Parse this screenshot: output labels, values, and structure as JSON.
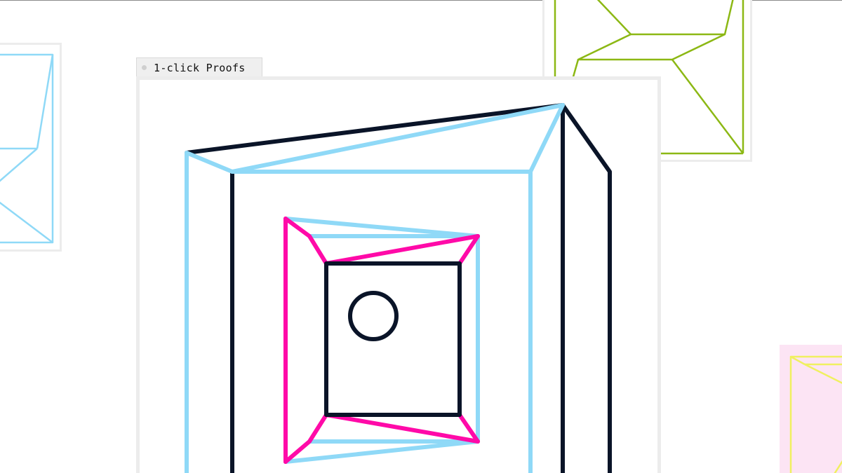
{
  "window": {
    "title": "1-click Proofs"
  },
  "icons": {
    "tab_dot": "window-status-dot",
    "main_artwork": "nested-frame-illustration",
    "left_thumbnail": "cyan-frame-thumbnail",
    "green_thumbnail": "green-frame-thumbnail",
    "pink_thumbnail": "yellow-frame-thumbnail"
  },
  "colors": {
    "background": "#ffffff",
    "frame_border": "#ececec",
    "navy": "#0a1428",
    "cyan": "#8fd9f7",
    "magenta": "#ff0aa8",
    "green": "#8cb814",
    "yellow": "#f0f060",
    "pink_fill": "#fce4f4"
  }
}
